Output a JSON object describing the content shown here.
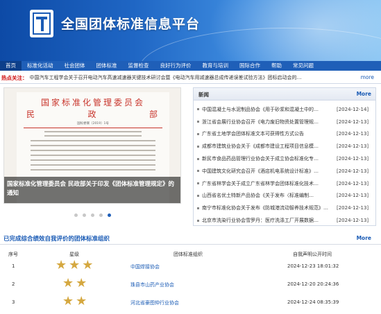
{
  "header": {
    "site_title": "全国团体标准信息平台"
  },
  "nav": {
    "items": [
      "首页",
      "标准化活动",
      "社会团体",
      "团体标准",
      "监督检查",
      "良好行为评价",
      "教育与培训",
      "国际合作",
      "帮助",
      "常见问题"
    ]
  },
  "hotspot": {
    "label": "热点关注：",
    "text": "中国汽车工程学会关于召开电动汽车高速减速器关键技术研讨会暨《电动汽车用减速器总成传递误差试验方法》团标启动会的…",
    "more": "more"
  },
  "slider": {
    "doc_header_line1": "国家标准化管理委员会",
    "doc_header_line2_left": "民",
    "doc_header_line2_mid": "政",
    "doc_header_line2_right": "部",
    "doc_number": "国标委联〔2019〕1号",
    "caption": "国家标准化管理委员会 民政部关于印发《团体标准管理规定》的通知",
    "dots": 5,
    "active_dot": 4
  },
  "news": {
    "title": "新闻",
    "more": "More",
    "items": [
      {
        "text": "中国混凝土与水泥制品协会《用于砂浆和混凝土中的…",
        "date": "[2024-12-14]"
      },
      {
        "text": "浙江省会展行业协会召开《电力废旧物资处置管理规…",
        "date": "[2024-12-13]"
      },
      {
        "text": "广东省土地学会团体标准文本可获得性方式公告",
        "date": "[2024-12-13]"
      },
      {
        "text": "成都市建筑业协会关于《成都市建设工程项目信息模…",
        "date": "[2024-12-13]"
      },
      {
        "text": "新民市食品药品管理行业协会关于成立协会标准化专…",
        "date": "[2024-12-13]"
      },
      {
        "text": "中国建筑文化研究会召开《酒店机电系统设计标准》…",
        "date": "[2024-12-13]"
      },
      {
        "text": "广东省林学会关于成立广东省林学会团体标准化技术…",
        "date": "[2024-12-13]"
      },
      {
        "text": "山西省名优土特新产品协会《关于发布〈标准编制…",
        "date": "[2024-12-13]"
      },
      {
        "text": "南宁市标准化协会关于发布《防城港流动智养技术规范》…",
        "date": "[2024-12-13]"
      },
      {
        "text": "北京市洗染行业协会雪罗丹：医疗洗涤工厂开展数据…",
        "date": "[2024-12-13]"
      }
    ]
  },
  "evaluation": {
    "title": "已完成综合绩效自我评价的团体标准组织",
    "more": "More",
    "columns": [
      "序号",
      "星级",
      "团体标准组织",
      "自我声明公开时间"
    ],
    "rows": [
      {
        "no": "1",
        "stars": 3,
        "org": "中国焊接协会",
        "time": "2024-12-23 18:01:32"
      },
      {
        "no": "2",
        "stars": 2,
        "org": "珠县市山药产业协会",
        "time": "2024-12-20 20:24:36"
      },
      {
        "no": "3",
        "stars": 2,
        "org": "河北省豪图仲行业协会",
        "time": "2024-12-24 08:35:39"
      }
    ]
  }
}
